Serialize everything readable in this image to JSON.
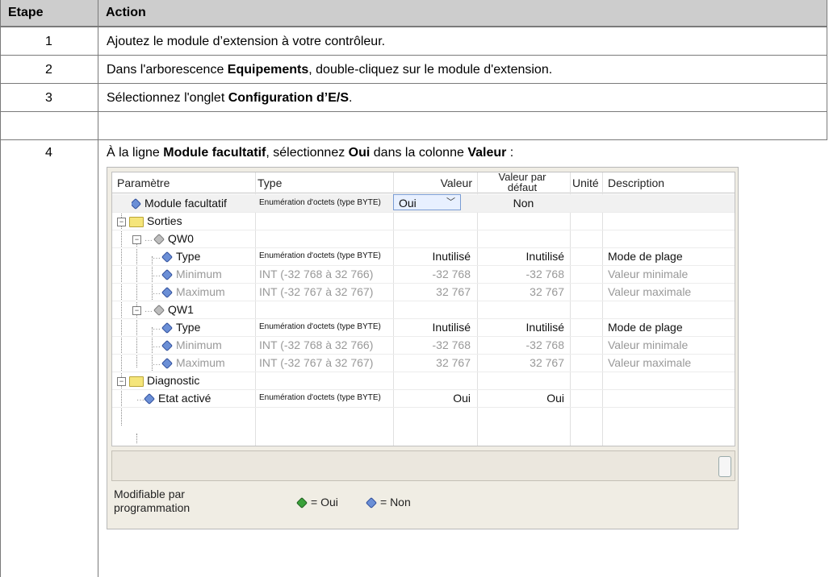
{
  "table": {
    "headers": [
      "Etape",
      "Action"
    ],
    "steps": [
      {
        "num": "1",
        "pre": "Ajoutez le module d’extension à votre contrôleur.",
        "b1": "",
        "mid": "",
        "b2": "",
        "post": ""
      },
      {
        "num": "2",
        "pre": "Dans l'arborescence ",
        "b1": "Equipements",
        "mid": ", double-cliquez sur le module d'extension.",
        "b2": "",
        "post": ""
      },
      {
        "num": "3",
        "pre": "Sélectionnez l'onglet ",
        "b1": "Configuration d’E/S",
        "mid": ".",
        "b2": "",
        "post": ""
      },
      {
        "num": "4",
        "pre": "À la ligne ",
        "b1": "Module facultatif",
        "mid": ", sélectionnez ",
        "b2": "Oui",
        "post": " dans la colonne ",
        "b3": "Valeur",
        "end": " :"
      }
    ]
  },
  "config": {
    "columns": {
      "param": "Paramètre",
      "type": "Type",
      "value": "Valeur",
      "default1": "Valeur par",
      "default2": "défaut",
      "unit": "Unité",
      "desc": "Description"
    },
    "rows": [
      {
        "name": "Module facultatif",
        "type": "Enumération d'octets (type BYTE)",
        "value": "Oui",
        "default": "Non",
        "desc": "",
        "kind": "combo"
      },
      {
        "name": "Sorties",
        "type": "",
        "value": "",
        "default": "",
        "desc": "",
        "kind": "folder"
      },
      {
        "name": "QW0",
        "type": "",
        "value": "",
        "default": "",
        "desc": "",
        "kind": "node"
      },
      {
        "name": "Type",
        "type": "Enumération d'octets (type BYTE)",
        "value": "Inutilisé",
        "default": "Inutilisé",
        "desc": "Mode de plage",
        "kind": "leaf"
      },
      {
        "name": "Minimum",
        "type": "INT (-32 768 à 32 766)",
        "value": "-32 768",
        "default": "-32 768",
        "desc": "Valeur minimale",
        "kind": "leafgray"
      },
      {
        "name": "Maximum",
        "type": "INT (-32 767 à 32 767)",
        "value": "32 767",
        "default": "32 767",
        "desc": "Valeur maximale",
        "kind": "leafgray"
      },
      {
        "name": "QW1",
        "type": "",
        "value": "",
        "default": "",
        "desc": "",
        "kind": "node"
      },
      {
        "name": "Type",
        "type": "Enumération d'octets (type BYTE)",
        "value": "Inutilisé",
        "default": "Inutilisé",
        "desc": "Mode de plage",
        "kind": "leaf"
      },
      {
        "name": "Minimum",
        "type": "INT (-32 768 à 32 766)",
        "value": "-32 768",
        "default": "-32 768",
        "desc": "Valeur minimale",
        "kind": "leafgray"
      },
      {
        "name": "Maximum",
        "type": "INT (-32 767 à 32 767)",
        "value": "32 767",
        "default": "32 767",
        "desc": "Valeur maximale",
        "kind": "leafgray"
      },
      {
        "name": "Diagnostic",
        "type": "",
        "value": "",
        "default": "",
        "desc": "",
        "kind": "folder"
      },
      {
        "name": "Etat activé",
        "type": "Enumération d'octets (type BYTE)",
        "value": "Oui",
        "default": "Oui",
        "desc": "",
        "kind": "leaf1"
      }
    ],
    "legend": {
      "label": "Modifiable par programmation",
      "yes": "= Oui",
      "no": "= Non"
    }
  },
  "icons": {
    "expand": "minus-expander-icon",
    "folder": "folder-icon",
    "param": "parameter-icon",
    "dropdown": "chevron-down-icon"
  },
  "colors": {
    "header_bg": "#cdcdcd",
    "folder": "#f5e57a",
    "param_blue": "#6b8fd6",
    "param_green": "#3aa13a"
  }
}
